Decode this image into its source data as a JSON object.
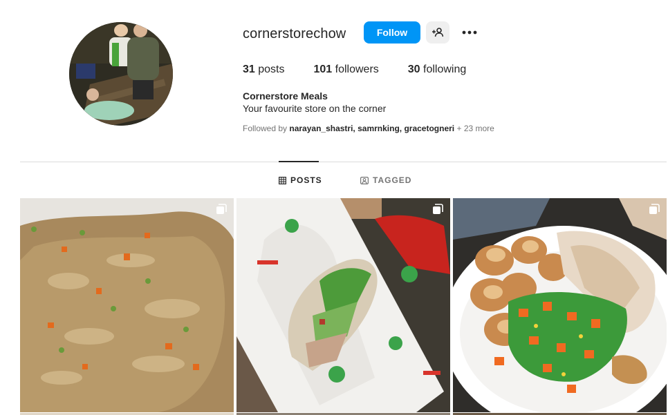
{
  "profile": {
    "username": "cornerstorechow",
    "follow_label": "Follow",
    "add_user_icon": "person-plus-icon",
    "more_icon": "ellipsis-icon",
    "stats": {
      "posts_count": "31",
      "posts_label": " posts",
      "followers_count": "101",
      "followers_label": " followers",
      "following_count": "30",
      "following_label": " following"
    },
    "full_name": "Cornerstore Meals",
    "bio": "Your favourite store on the corner",
    "followed_by_prefix": "Followed by ",
    "followed_by_names": "narayan_shastri, samrnking, gracetogneri",
    "followed_by_more": " + 23 more"
  },
  "tabs": [
    {
      "label": "POSTS",
      "icon": "grid-icon",
      "active": true
    },
    {
      "label": "TAGGED",
      "icon": "tag-person-icon",
      "active": false
    }
  ],
  "posts": [
    {
      "subject": "fried-rice",
      "icon": "carousel-icon"
    },
    {
      "subject": "wrap",
      "icon": "carousel-icon"
    },
    {
      "subject": "roast-dinner",
      "icon": "carousel-icon"
    }
  ],
  "colors": {
    "accent": "#0095f6",
    "text": "#262626",
    "muted": "#737373",
    "divider": "#dbdbdb"
  }
}
